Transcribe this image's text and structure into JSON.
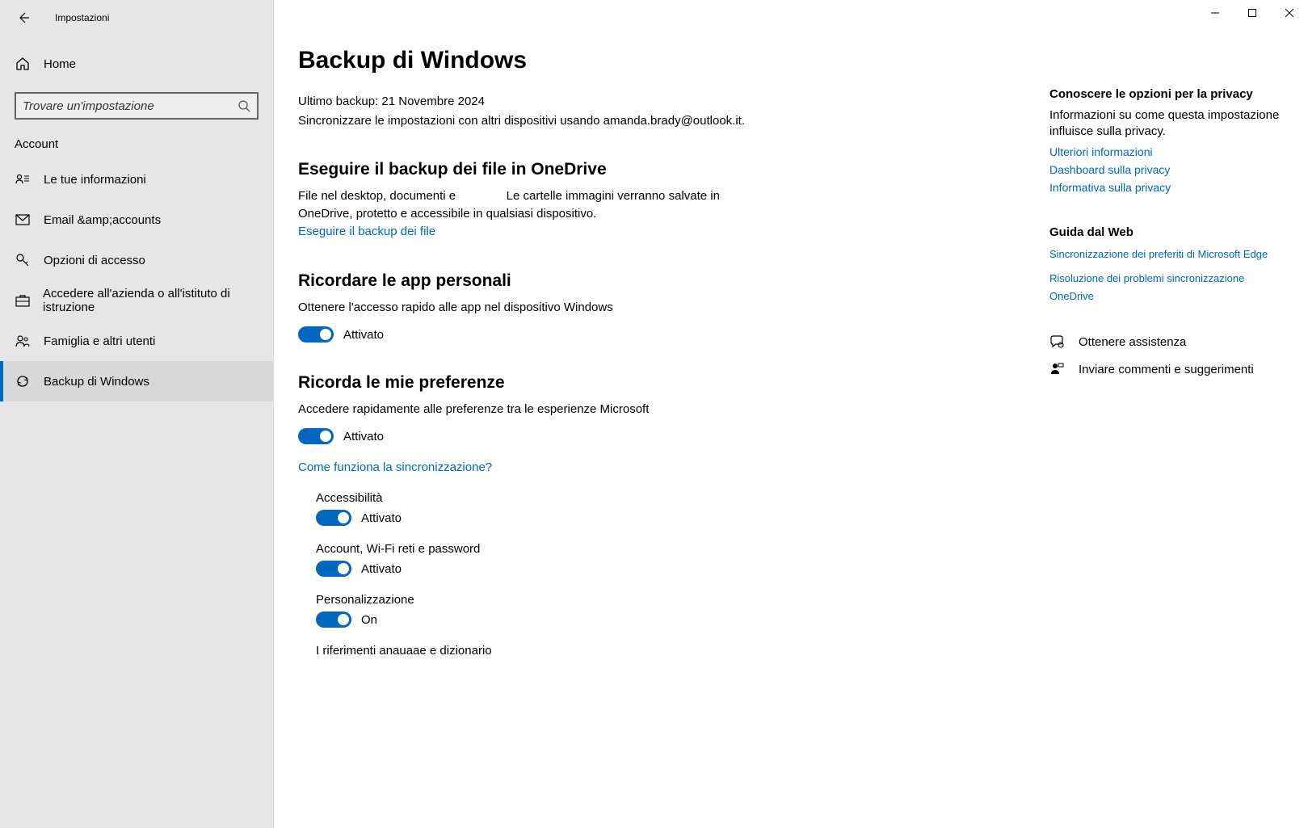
{
  "window": {
    "title": "Impostazioni"
  },
  "sidebar": {
    "home": "Home",
    "search_placeholder": "Trovare un'impostazione",
    "category": "Account",
    "items": [
      {
        "label": "Le tue informazioni"
      },
      {
        "label": "Email &amp;accounts"
      },
      {
        "label": "Opzioni di accesso"
      },
      {
        "label": "Accedere all'azienda o all'istituto di istruzione"
      },
      {
        "label": "Famiglia e altri utenti"
      },
      {
        "label": "Backup di Windows"
      }
    ]
  },
  "main": {
    "title": "Backup di Windows",
    "last_backup_label": "Ultimo backup:",
    "last_backup_value": "21 Novembre 2024",
    "sync_text": "Sincronizzare le impostazioni con altri dispositivi usando amanda.brady@outlook.it.",
    "onedrive": {
      "heading": "Eseguire il backup dei file in OneDrive",
      "desc_a": "File nel desktop, documenti e",
      "desc_b": "Le cartelle immagini verranno salvate in OneDrive, protetto e accessibile in qualsiasi dispositivo.",
      "link": "Eseguire il backup dei file"
    },
    "apps": {
      "heading": "Ricordare le app personali",
      "desc": "Ottenere l'accesso rapido alle app nel dispositivo Windows",
      "state": "Attivato"
    },
    "prefs": {
      "heading": "Ricorda le mie preferenze",
      "desc": "Accedere rapidamente alle preferenze tra le esperienze Microsoft",
      "state": "Attivato",
      "how": "Come funziona la sincronizzazione?",
      "subs": [
        {
          "label": "Accessibilità",
          "state": "Attivato"
        },
        {
          "label": "Account, Wi-Fi reti e password",
          "state": "Attivato"
        },
        {
          "label": "Personalizzazione",
          "state": "On"
        },
        {
          "label": "I riferimenti anauaae e dizionario",
          "state": ""
        }
      ]
    }
  },
  "right": {
    "privacy_heading": "Conoscere le opzioni per la privacy",
    "privacy_desc": "Informazioni su come questa impostazione influisce sulla privacy.",
    "links1": [
      "Ulteriori informazioni",
      "Dashboard sulla privacy",
      "Informativa sulla privacy"
    ],
    "web_heading": "Guida dal Web",
    "links2": [
      "Sincronizzazione dei preferiti di Microsoft Edge",
      "Risoluzione dei problemi sincronizzazione OneDrive"
    ],
    "help": "Ottenere assistenza",
    "feedback": "Inviare commenti e suggerimenti"
  }
}
